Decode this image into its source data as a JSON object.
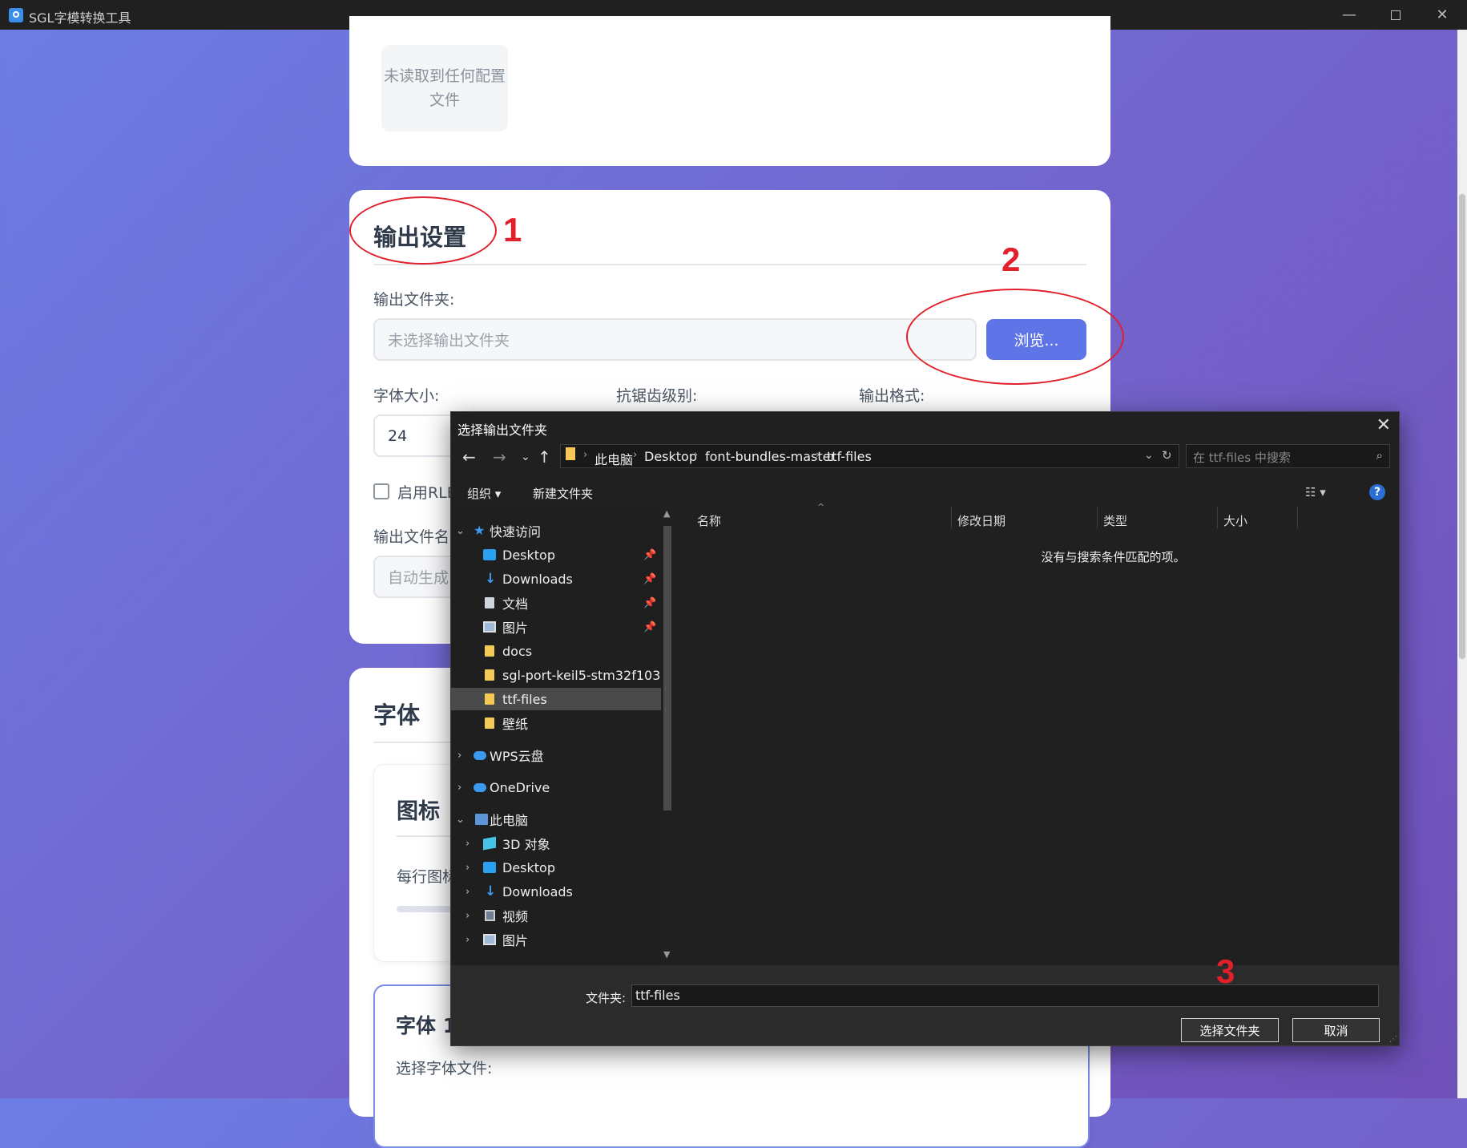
{
  "window": {
    "title": "SGL字模转换工具"
  },
  "config_card": {
    "empty_text": "未读取到任何配置文件"
  },
  "output_settings": {
    "title": "输出设置",
    "folder_label": "输出文件夹:",
    "folder_placeholder": "未选择输出文件夹",
    "browse_label": "浏览...",
    "font_size_label": "字体大小:",
    "font_size_value": "24",
    "antialias_label": "抗锯齿级别:",
    "format_label": "输出格式:",
    "rle_label": "启用RLE",
    "filename_label": "输出文件名",
    "filename_placeholder": "自动生成"
  },
  "font_section": {
    "title": "字体",
    "icon_card_title": "图标",
    "icon_row_label": "每行图标",
    "font1_title": "字体 1",
    "select_font_label": "选择字体文件:"
  },
  "annotations": [
    "1",
    "2",
    "3"
  ],
  "dialog": {
    "title": "选择输出文件夹",
    "breadcrumb": [
      "此电脑",
      "Desktop",
      "font-bundles-master",
      "ttf-files"
    ],
    "search_placeholder": "在 ttf-files 中搜索",
    "toolbar": {
      "organize": "组织 ▾",
      "new_folder": "新建文件夹"
    },
    "nav": {
      "quick_access": "快速访问",
      "quick_items": [
        {
          "label": "Desktop",
          "icon": "desktop-icon"
        },
        {
          "label": "Downloads",
          "icon": "download-icon"
        },
        {
          "label": "文档",
          "icon": "document-icon"
        },
        {
          "label": "图片",
          "icon": "picture-icon"
        },
        {
          "label": "docs",
          "icon": "folder-icon"
        },
        {
          "label": "sgl-port-keil5-stm32f103",
          "icon": "folder-icon"
        },
        {
          "label": "ttf-files",
          "icon": "folder-icon"
        },
        {
          "label": "壁纸",
          "icon": "folder-icon"
        }
      ],
      "wps_cloud": "WPS云盘",
      "onedrive": "OneDrive",
      "this_pc": "此电脑",
      "pc_items": [
        {
          "label": "3D 对象",
          "icon": "3d-objects-icon"
        },
        {
          "label": "Desktop",
          "icon": "desktop-icon"
        },
        {
          "label": "Downloads",
          "icon": "download-icon"
        },
        {
          "label": "视频",
          "icon": "video-icon"
        },
        {
          "label": "图片",
          "icon": "picture-icon"
        }
      ]
    },
    "columns": [
      "名称",
      "修改日期",
      "类型",
      "大小"
    ],
    "empty_message": "没有与搜索条件匹配的项。",
    "folder_field_label": "文件夹:",
    "folder_field_value": "ttf-files",
    "select_button": "选择文件夹",
    "cancel_button": "取消"
  }
}
